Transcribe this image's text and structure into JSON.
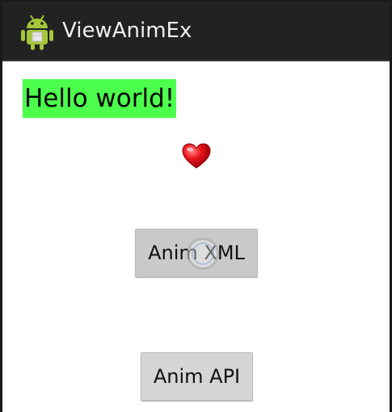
{
  "action_bar": {
    "title": "ViewAnimEx",
    "icon": "android-robot-icon",
    "background_color": "#222222"
  },
  "content": {
    "hello_text": "Hello world!",
    "hello_highlight_color": "#4cff4c",
    "heart_icon": "heart-icon",
    "buttons": [
      {
        "label": "Anim XML",
        "state": "pressed"
      },
      {
        "label": "Anim API"
      }
    ]
  }
}
